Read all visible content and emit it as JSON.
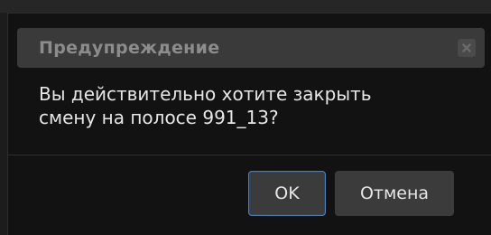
{
  "dialog": {
    "title": "Предупреждение",
    "message_line1": "Вы действительно хотите закрыть",
    "message_line2": "смену на полосе 991_13?",
    "close_icon": "close-icon",
    "buttons": {
      "ok_label": "OK",
      "cancel_label": "Отмена"
    }
  },
  "colors": {
    "background": "#121212",
    "titlebar": "#3a3a3a",
    "button": "#3b3b3b",
    "focus_border": "#4f7fb3"
  }
}
